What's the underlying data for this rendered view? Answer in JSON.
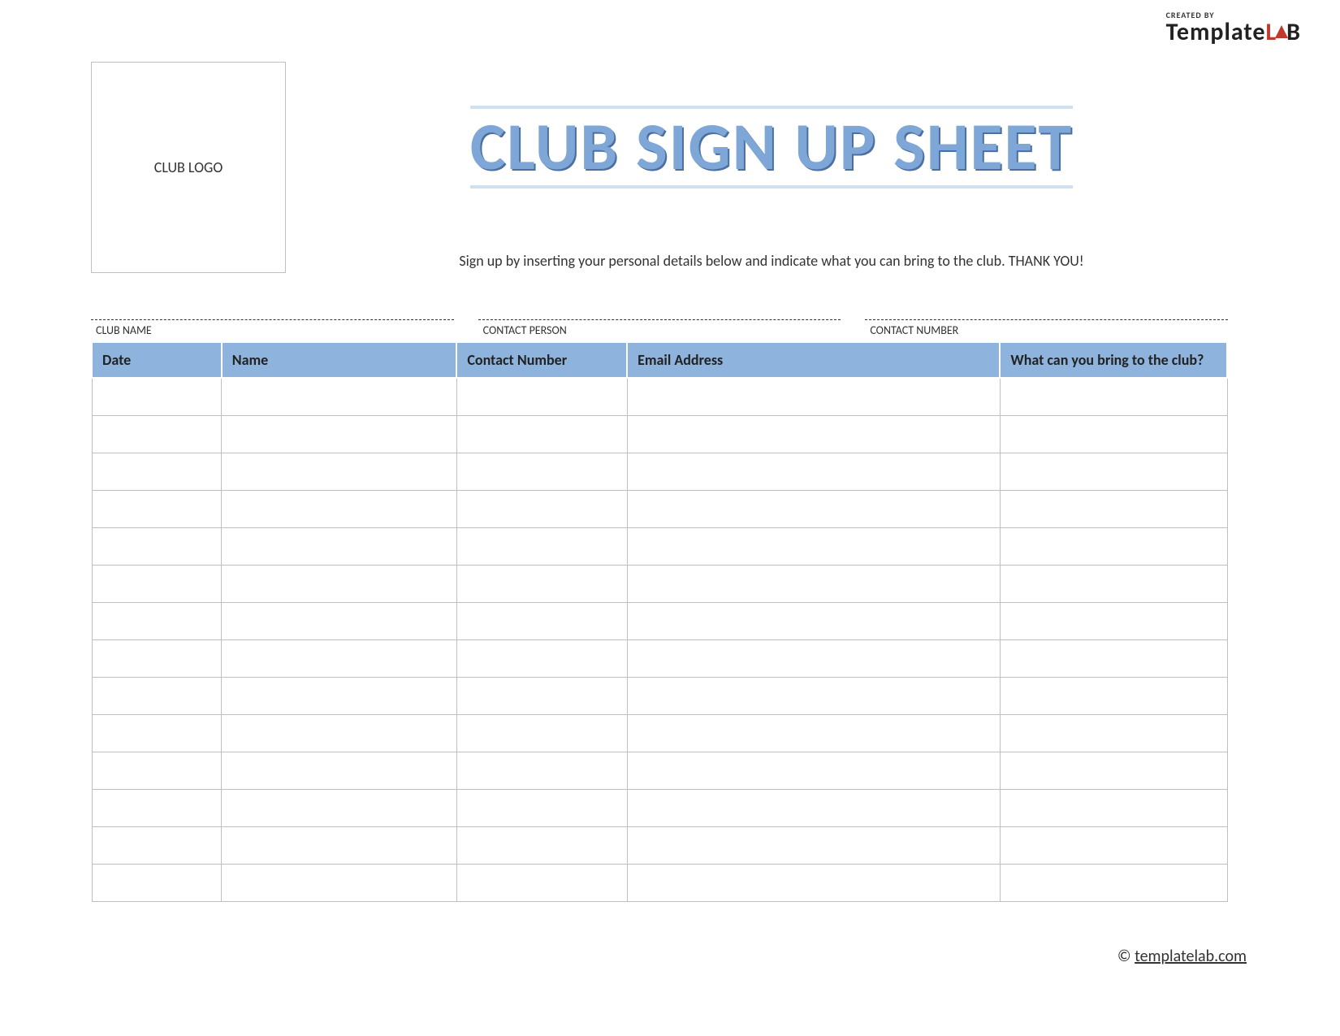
{
  "brand": {
    "created_by": "CREATED BY",
    "name_template": "Template",
    "name_lab_l": "L",
    "name_lab_b": "B"
  },
  "logo_placeholder": "CLUB LOGO",
  "title": "CLUB SIGN UP SHEET",
  "subtitle": "Sign up by inserting your personal details below and indicate what you can bring to the club. THANK YOU!",
  "info_fields": {
    "club_name_label": "CLUB NAME",
    "contact_person_label": "CONTACT PERSON",
    "contact_number_label": "CONTACT NUMBER"
  },
  "table": {
    "headers": {
      "date": "Date",
      "name": "Name",
      "contact": "Contact Number",
      "email": "Email Address",
      "bring": "What can you bring to the club?"
    },
    "row_count": 14
  },
  "footer": {
    "copyright": "©",
    "link_text": "templatelab.com"
  }
}
